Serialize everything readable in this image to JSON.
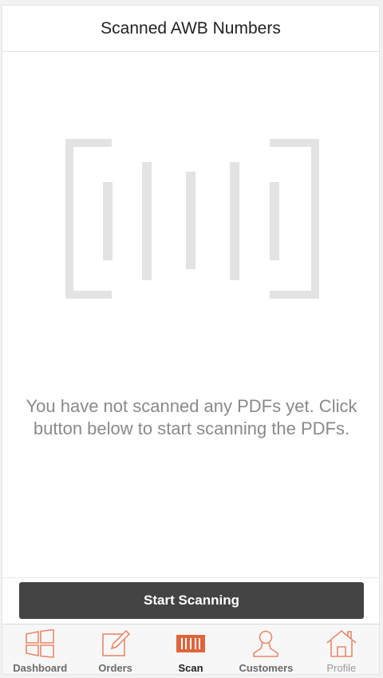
{
  "header": {
    "title": "Scanned AWB Numbers"
  },
  "empty_state": {
    "icon": "barcode-placeholder-icon",
    "message": "You have not scanned any PDFs yet. Click button below to start scanning the PDFs."
  },
  "actions": {
    "start_label": "Start Scanning"
  },
  "tabbar": {
    "items": [
      {
        "label": "Dashboard",
        "icon": "dashboard-icon"
      },
      {
        "label": "Orders",
        "icon": "orders-icon"
      },
      {
        "label": "Scan",
        "icon": "scan-icon"
      },
      {
        "label": "Customers",
        "icon": "customers-icon"
      },
      {
        "label": "Profile",
        "icon": "profile-home-icon"
      }
    ],
    "active": "Scan"
  },
  "colors": {
    "accent": "#e8896a",
    "accent_active": "#e0643c",
    "button": "#444444",
    "placeholder": "#e3e3e3",
    "message": "#8a8a8a"
  }
}
